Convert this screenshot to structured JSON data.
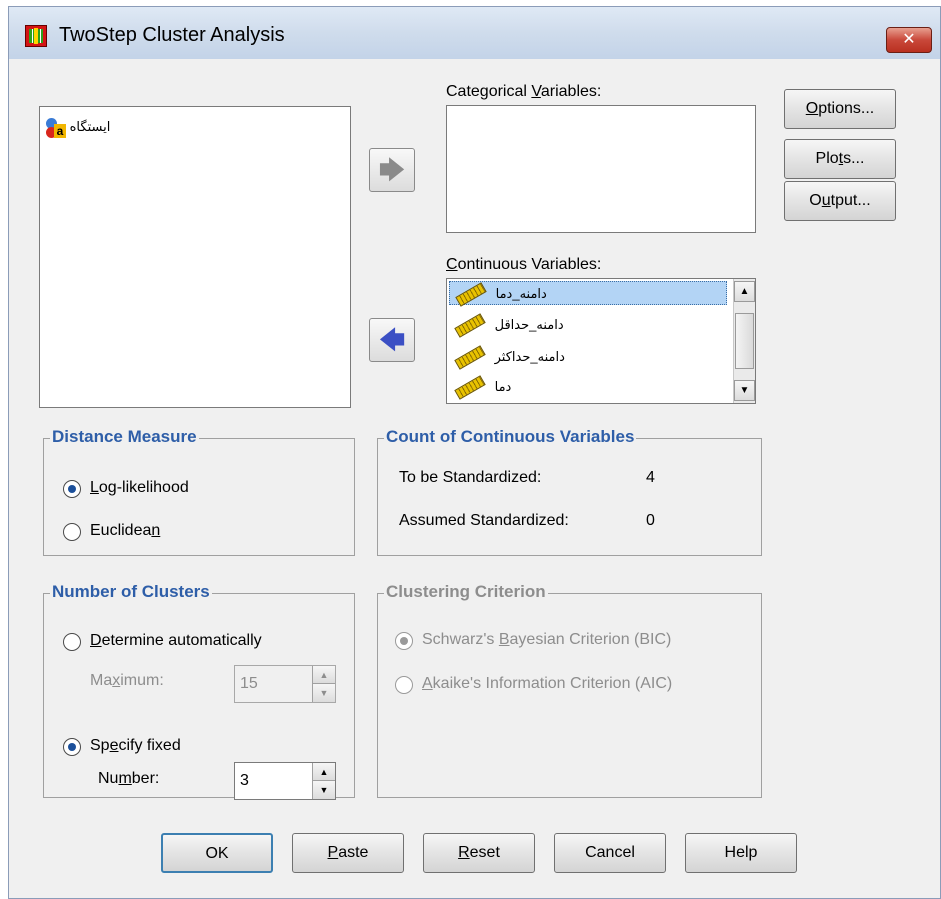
{
  "window": {
    "title": "TwoStep Cluster Analysis",
    "close_label": "✕"
  },
  "source_list": {
    "items": [
      {
        "label": "ايستگاه",
        "icon": "nominal-variable-icon"
      }
    ]
  },
  "categorical": {
    "label": "Categorical Variables:",
    "items": []
  },
  "continuous": {
    "label": "Continuous Variables:",
    "items": [
      {
        "label": "دامنه_دما",
        "icon": "scale-variable-icon"
      },
      {
        "label": "دامنه_حداقل",
        "icon": "scale-variable-icon"
      },
      {
        "label": "دامنه_حداكثر",
        "icon": "scale-variable-icon"
      },
      {
        "label": "دما",
        "icon": "scale-variable-icon"
      }
    ]
  },
  "side_buttons": {
    "options": "Options...",
    "plots": "Plots...",
    "output": "Output..."
  },
  "distance": {
    "title": "Distance Measure",
    "log_likelihood": "Log-likelihood",
    "euclidean": "Euclidean",
    "selected": "Log-likelihood"
  },
  "count": {
    "title": "Count of Continuous Variables",
    "standardized_label": "To be Standardized:",
    "standardized_value": "4",
    "assumed_label": "Assumed Standardized:",
    "assumed_value": "0"
  },
  "clusters": {
    "title": "Number of Clusters",
    "auto_label": "Determine automatically",
    "maximum_label": "Maximum:",
    "maximum_value": "15",
    "fixed_label": "Specify fixed",
    "number_label": "Number:",
    "number_value": "3",
    "selected": "Specify fixed"
  },
  "criterion": {
    "title": "Clustering Criterion",
    "bic": "Schwarz's Bayesian Criterion (BIC)",
    "aic": "Akaike's Information Criterion (AIC)",
    "selected": "BIC"
  },
  "bottom_buttons": {
    "ok": "OK",
    "paste": "Paste",
    "reset": "Reset",
    "cancel": "Cancel",
    "help": "Help"
  },
  "colors": {
    "group_title": "#2e5ea8",
    "titlebar": "#cfdcec",
    "close": "#c9483a",
    "selection": "#b3d4f5"
  }
}
